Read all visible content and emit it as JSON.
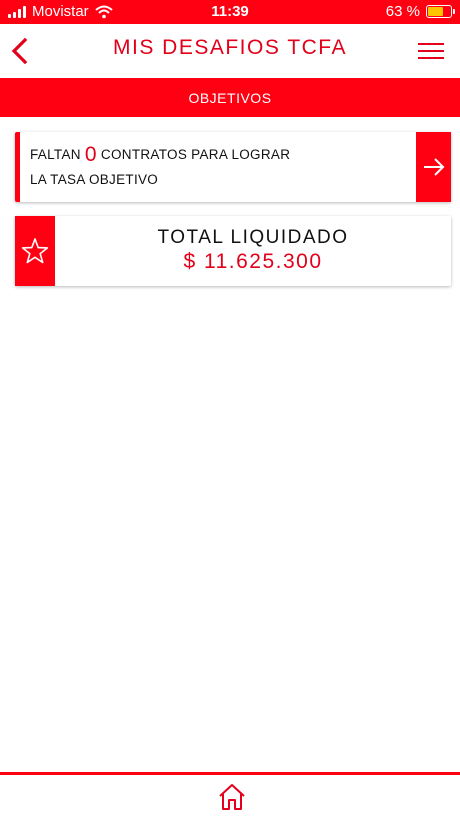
{
  "status_bar": {
    "carrier": "Movistar",
    "time": "11:39",
    "battery": "63 %",
    "battery_level": 0.63
  },
  "header": {
    "title": "MIS DESAFIOS TCFA"
  },
  "section": {
    "label": "OBJETIVOS"
  },
  "objective_card": {
    "prefix": "FALTAN",
    "count": "0",
    "suffix": "CONTRATOS PARA LOGRAR",
    "line2": "LA TASA OBJETIVO"
  },
  "total_card": {
    "label": "TOTAL LIQUIDADO",
    "value": "$ 11.625.300"
  },
  "icons": {
    "back": "chevron-left-icon",
    "menu": "hamburger-menu-icon",
    "arrow": "arrow-right-icon",
    "star": "star-icon",
    "home": "home-icon",
    "wifi": "wifi-icon",
    "signal": "signal-icon",
    "battery": "battery-icon"
  },
  "colors": {
    "brand_red": "#ff0013",
    "text_red": "#e2001a",
    "battery_yellow": "#ffc400"
  }
}
